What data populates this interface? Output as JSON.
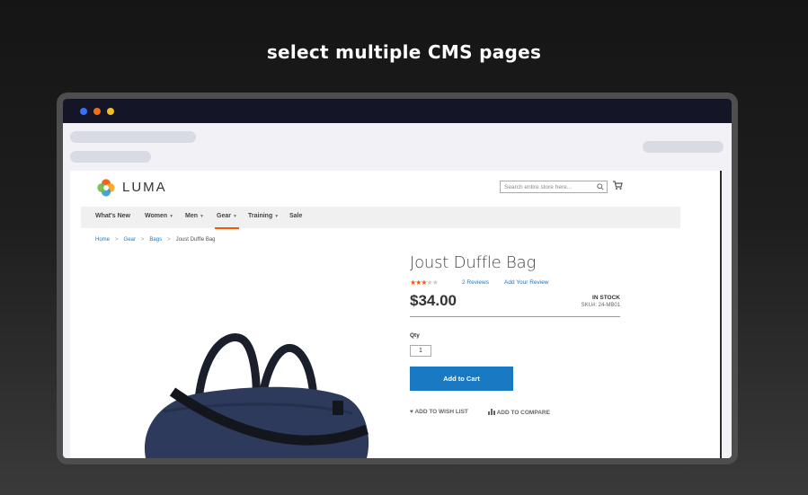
{
  "headline": "select multiple CMS pages",
  "store": {
    "brand": "LUMA",
    "search_placeholder": "Search entire store here...",
    "nav": [
      {
        "label": "What's New",
        "has_caret": false
      },
      {
        "label": "Women",
        "has_caret": true
      },
      {
        "label": "Men",
        "has_caret": true
      },
      {
        "label": "Gear",
        "has_caret": true,
        "active": true
      },
      {
        "label": "Training",
        "has_caret": true
      },
      {
        "label": "Sale",
        "has_caret": false
      }
    ],
    "breadcrumb": [
      "Home",
      "Gear",
      "Bags",
      "Joust Duffle Bag"
    ],
    "product": {
      "title": "Joust Duffle Bag",
      "rating_stars": 3,
      "rating_max": 5,
      "reviews": "2  Reviews",
      "add_review": "Add Your Review",
      "price": "$34.00",
      "stock": "IN STOCK",
      "sku": "SKU#:  24-MB01",
      "qty_label": "Qty",
      "qty_value": "1",
      "add_to_cart": "Add to Cart",
      "wishlist": "ADD TO WISH LIST",
      "compare": "ADD TO COMPARE"
    }
  },
  "colors": {
    "accent": "#1979c3",
    "nav_active": "#ff5501",
    "dot_blue": "#3b6ff5",
    "dot_orange": "#f07018",
    "dot_yellow": "#f0c020"
  }
}
